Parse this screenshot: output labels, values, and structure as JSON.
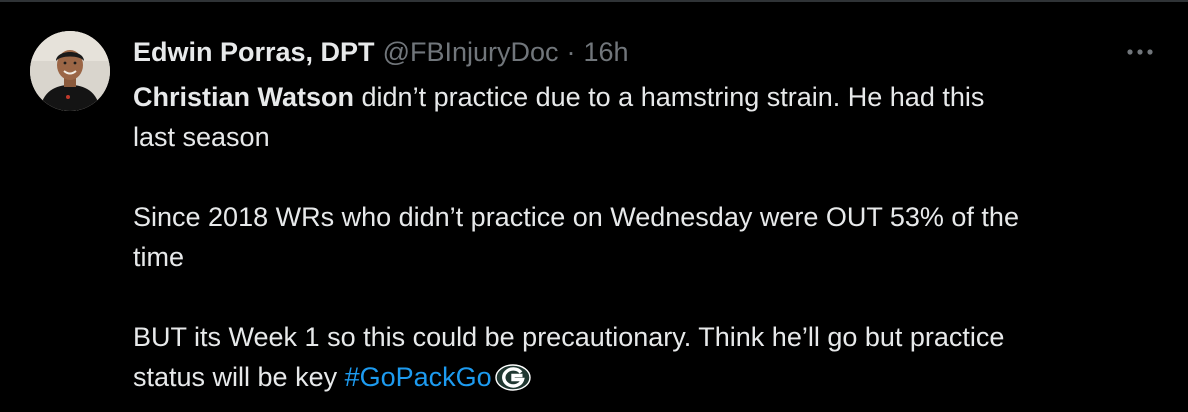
{
  "tweet": {
    "author": {
      "display_name": "Edwin Porras, DPT",
      "handle": "@FBInjuryDoc",
      "separator": "·",
      "timestamp": "16h"
    },
    "paragraph1": {
      "bold_lead": "Christian Watson",
      "rest_line1": " didn’t practice due to a hamstring strain. He had this",
      "rest_line2": "last season"
    },
    "paragraph2": {
      "line1": "Since 2018 WRs who didn’t practice on Wednesday were OUT 53% of the",
      "line2": "time"
    },
    "paragraph3": {
      "line1": "BUT its Week 1 so this could be precautionary. Think he’ll go but practice",
      "line2_text": "status will be key ",
      "hashtag": "#GoPackGo"
    },
    "hashtag_emoji_icon": "green-bay-packers-logo-icon",
    "more_icon": "more-horizontal-icon"
  },
  "colors": {
    "background": "#000000",
    "text": "#e7e9ea",
    "secondary_text": "#71767b",
    "link": "#1d9bf0",
    "divider": "#2f3336",
    "packers_green": "#203731",
    "packers_gold": "#ffb612"
  }
}
